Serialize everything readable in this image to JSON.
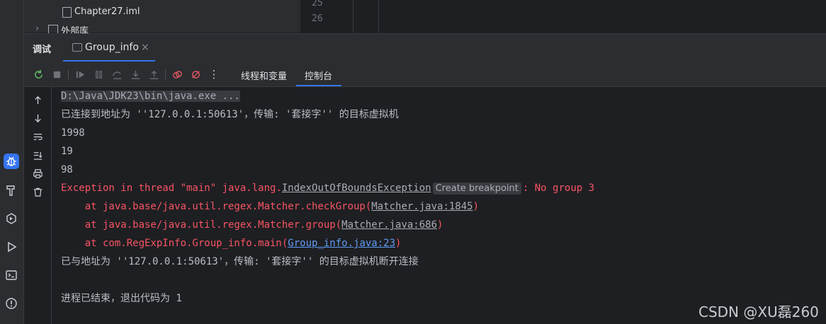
{
  "project_tree": {
    "file_item": "Chapter27.iml",
    "external_libs": "外部库"
  },
  "editor": {
    "line_numbers": [
      "25",
      "26"
    ]
  },
  "tool_window": {
    "title": "调试",
    "tab_label": "Group_info",
    "tab_close": "×"
  },
  "toolbar": {
    "tab_threads": "线程和变量",
    "tab_console": "控制台",
    "more": "⋮"
  },
  "console": {
    "cmd": "D:\\Java\\JDK23\\bin\\java.exe ...",
    "connected": "已连接到地址为 ''127.0.0.1:50613'，传输: '套接字'' 的目标虚拟机",
    "out1": "1998",
    "out2": "19",
    "out3": "98",
    "exc_prefix": "Exception in thread \"main\" java.lang.",
    "exc_class": "IndexOutOfBoundsException",
    "inlay_hint": "Create breakpoint",
    "exc_suffix": ": No group 3",
    "st1_prefix": "    at java.base/java.util.regex.Matcher.checkGroup(",
    "st1_link": "Matcher.java:1845",
    "st1_suffix": ")",
    "st2_prefix": "    at java.base/java.util.regex.Matcher.group(",
    "st2_link": "Matcher.java:686",
    "st2_suffix": ")",
    "st3_prefix": "    at com.RegExpInfo.Group_info.main(",
    "st3_link": "Group_info.java:23",
    "st3_suffix": ")",
    "disconnected": "已与地址为 ''127.0.0.1:50613'，传输: '套接字'' 的目标虚拟机断开连接",
    "finished": "进程已结束，退出代码为 1"
  },
  "watermark": "CSDN @XU磊260",
  "colors": {
    "accent": "#3574f0",
    "error": "#f75464",
    "link": "#5f9cf5",
    "background": "#1e1f22",
    "panel": "#2b2d30"
  }
}
